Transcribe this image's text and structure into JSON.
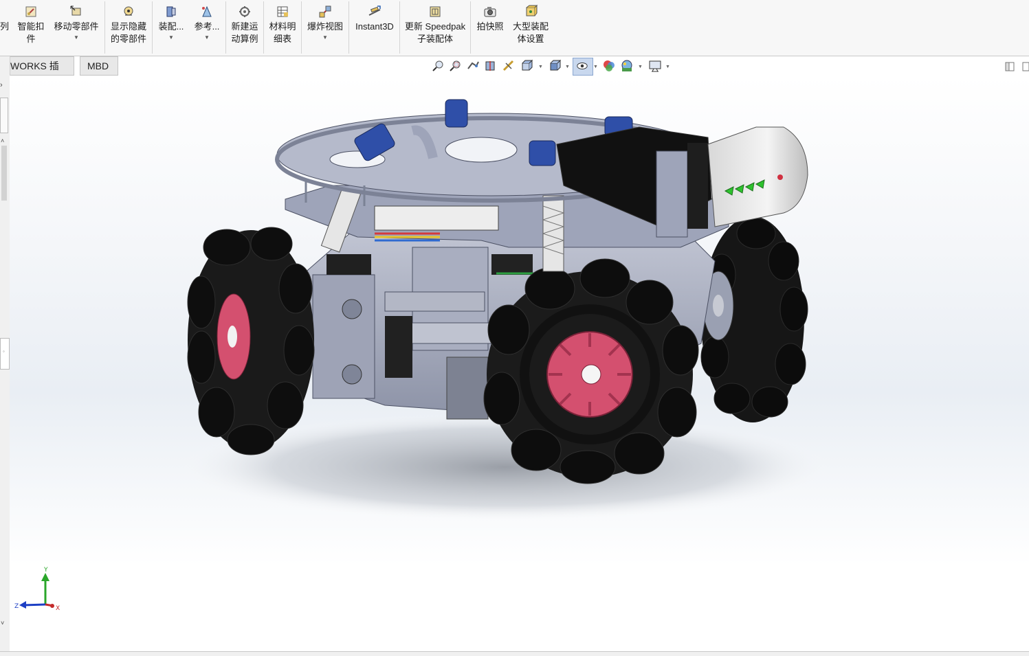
{
  "ribbon": {
    "items": [
      {
        "id": "partial",
        "label": "列",
        "label2": "",
        "icon": "",
        "drop": false
      },
      {
        "id": "smart-fasteners",
        "label": "智能扣",
        "label2": "件",
        "icon": "smart-fastener-icon",
        "drop": false
      },
      {
        "id": "move-component",
        "label": "移动零部件",
        "label2": "",
        "icon": "move-component-icon",
        "drop": true
      },
      {
        "id": "show-hidden",
        "label": "显示隐藏",
        "label2": "的零部件",
        "icon": "show-hidden-icon",
        "drop": false
      },
      {
        "id": "assembly-features",
        "label": "装配...",
        "label2": "",
        "icon": "assembly-feature-icon",
        "drop": true
      },
      {
        "id": "reference",
        "label": "参考...",
        "label2": "",
        "icon": "reference-geometry-icon",
        "drop": true
      },
      {
        "id": "new-motion-study",
        "label": "新建运",
        "label2": "动算例",
        "icon": "motion-study-icon",
        "drop": false
      },
      {
        "id": "bill-of-materials",
        "label": "材料明",
        "label2": "细表",
        "icon": "bom-icon",
        "drop": false
      },
      {
        "id": "exploded-view",
        "label": "爆炸视图",
        "label2": "",
        "icon": "exploded-view-icon",
        "drop": true
      },
      {
        "id": "instant3d",
        "label": "Instant3D",
        "label2": "",
        "icon": "instant3d-icon",
        "drop": false
      },
      {
        "id": "update-speedpak",
        "label": "更新 Speedpak",
        "label2": "子装配体",
        "icon": "speedpak-icon",
        "drop": false
      },
      {
        "id": "take-snapshot",
        "label": "拍快照",
        "label2": "",
        "icon": "camera-icon",
        "drop": false
      },
      {
        "id": "large-assembly",
        "label": "大型装配",
        "label2": "体设置",
        "icon": "large-assembly-icon",
        "drop": false
      }
    ]
  },
  "tabs": [
    {
      "id": "addins",
      "label": "IDWORKS 插件"
    },
    {
      "id": "mbd",
      "label": "MBD"
    }
  ],
  "triad": {
    "x": "X",
    "y": "Y",
    "z": "Z"
  },
  "colors": {
    "hub": "#d4506f",
    "plate": "#9ea4b9",
    "wheel": "#151515",
    "accent_blue": "#2f4fa8"
  }
}
